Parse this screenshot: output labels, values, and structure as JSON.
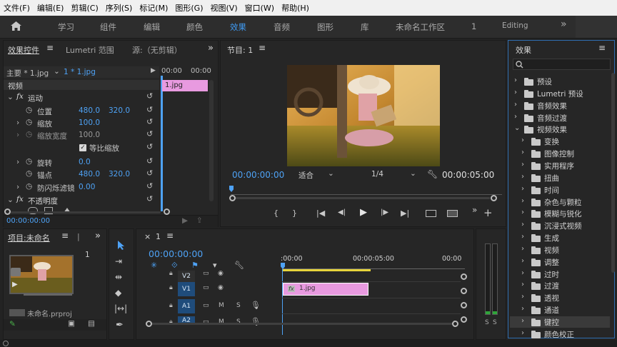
{
  "menu": [
    "文件(F)",
    "编辑(E)",
    "剪辑(C)",
    "序列(S)",
    "标记(M)",
    "图形(G)",
    "视图(V)",
    "窗口(W)",
    "帮助(H)"
  ],
  "workspaces": [
    "学习",
    "组件",
    "编辑",
    "颜色",
    "效果",
    "音频",
    "图形",
    "库",
    "未命名工作区",
    "1",
    "Editing"
  ],
  "overflow_glyph": "»",
  "effect_controls": {
    "tabs": [
      "效果控件",
      "Lumetri 范围",
      "源:（无剪辑）"
    ],
    "master": "主要 * 1.jpg",
    "clip": "1 * 1.jpg",
    "time_a": "00:00",
    "time_b": "00:00",
    "clip_bar": "1.jpg",
    "section_video": "视频",
    "motion": "运动",
    "position": "位置",
    "position_x": "480.0",
    "position_y": "320.0",
    "scale": "缩放",
    "scale_val": "100.0",
    "scale_width": "缩放宽度",
    "scale_width_val": "100.0",
    "uniform_scale": "等比缩放",
    "rotation": "旋转",
    "rotation_val": "0.0",
    "anchor": "锚点",
    "anchor_x": "480.0",
    "anchor_y": "320.0",
    "anti_flicker": "防闪烁滤镜",
    "anti_flicker_val": "0.00",
    "opacity": "不透明度",
    "timecode": "00:00:00:00"
  },
  "program": {
    "title": "节目: 1",
    "timecode": "00:00:00:00",
    "fit": "适合",
    "ratio": "1/4",
    "duration": "00:00:05:00"
  },
  "effects_panel": {
    "title": "效果",
    "items": [
      {
        "label": "预设",
        "level": 0,
        "open": false,
        "icon": "preset"
      },
      {
        "label": "Lumetri 预设",
        "level": 0,
        "open": false,
        "icon": "preset"
      },
      {
        "label": "音频效果",
        "level": 0,
        "open": false,
        "icon": "folder"
      },
      {
        "label": "音频过渡",
        "level": 0,
        "open": false,
        "icon": "folder"
      },
      {
        "label": "视频效果",
        "level": 0,
        "open": true,
        "icon": "folder"
      },
      {
        "label": "变换",
        "level": 1,
        "open": false,
        "icon": "folder"
      },
      {
        "label": "图像控制",
        "level": 1,
        "open": false,
        "icon": "folder"
      },
      {
        "label": "实用程序",
        "level": 1,
        "open": false,
        "icon": "folder"
      },
      {
        "label": "扭曲",
        "level": 1,
        "open": false,
        "icon": "folder"
      },
      {
        "label": "时间",
        "level": 1,
        "open": false,
        "icon": "folder"
      },
      {
        "label": "杂色与颗粒",
        "level": 1,
        "open": false,
        "icon": "folder"
      },
      {
        "label": "模糊与锐化",
        "level": 1,
        "open": false,
        "icon": "folder"
      },
      {
        "label": "沉浸式视频",
        "level": 1,
        "open": false,
        "icon": "folder"
      },
      {
        "label": "生成",
        "level": 1,
        "open": false,
        "icon": "folder"
      },
      {
        "label": "视频",
        "level": 1,
        "open": false,
        "icon": "folder"
      },
      {
        "label": "调整",
        "level": 1,
        "open": false,
        "icon": "folder"
      },
      {
        "label": "过时",
        "level": 1,
        "open": false,
        "icon": "folder"
      },
      {
        "label": "过渡",
        "level": 1,
        "open": false,
        "icon": "folder"
      },
      {
        "label": "透视",
        "level": 1,
        "open": false,
        "icon": "folder"
      },
      {
        "label": "通道",
        "level": 1,
        "open": false,
        "icon": "folder"
      },
      {
        "label": "键控",
        "level": 1,
        "open": false,
        "icon": "folder",
        "selected": true
      },
      {
        "label": "颜色校正",
        "level": 1,
        "open": false,
        "icon": "folder"
      }
    ]
  },
  "project": {
    "title": "项目:未命名",
    "count": "1",
    "file": "未命名.prproj"
  },
  "timeline": {
    "title": "1",
    "timecode": "00:00:00:00",
    "ruler": [
      ":00:00",
      "00:00:05:00",
      "00:00"
    ],
    "tracks": [
      "V2",
      "V1",
      "A1",
      "A2"
    ],
    "clip": "1.jpg",
    "fx_badge": "fx",
    "track_buttons": [
      "M",
      "S"
    ]
  },
  "audio_meter": {
    "labels": [
      "S",
      "S"
    ]
  }
}
